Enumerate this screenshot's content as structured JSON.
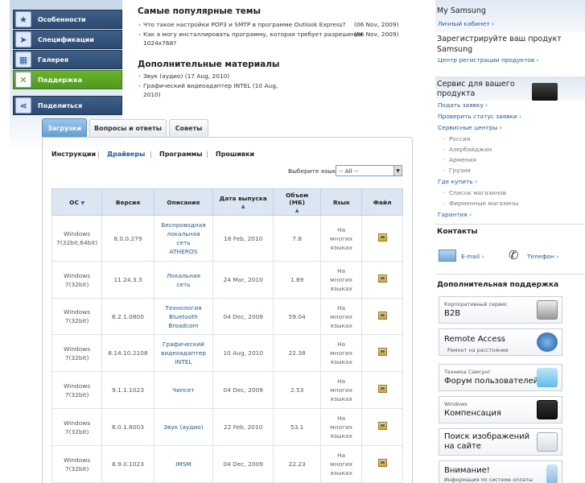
{
  "left_nav": [
    {
      "label": "Особенности",
      "icon": "star-icon"
    },
    {
      "label": "Спецификации",
      "icon": "cursor-icon"
    },
    {
      "label": "Галерея",
      "icon": "gallery-icon"
    },
    {
      "label": "Поддержка",
      "icon": "tools-icon",
      "active": true
    },
    {
      "label": "Поделиться",
      "icon": "share-icon"
    }
  ],
  "popular": {
    "title": "Самые популярные темы",
    "items": [
      {
        "text": "Что такое настройки POP3 и SMTP в программе Outlook Express?",
        "date": "(06 Nov, 2009)"
      },
      {
        "text": "Как я могу инсталлировать программу, которая требует разрешения",
        "text2": "1024x768?",
        "date": "(06 Nov, 2009)"
      }
    ]
  },
  "extra": {
    "title": "Дополнительные материалы",
    "item1": "Звук (аудио)   (17 Aug, 2010)",
    "item2a": "Графический видеоадаптер INTEL   (10 Aug,",
    "item2b": "2010)"
  },
  "tabs": [
    "Загрузки",
    "Вопросы и ответы",
    "Советы"
  ],
  "subtabs": [
    "Инструкции",
    "Драйверы",
    "Программы",
    "Прошивки"
  ],
  "language": {
    "label": "Выберите язык",
    "value": "-- All --"
  },
  "table": {
    "headers": [
      "ОС",
      "Версия",
      "Описание",
      "Дата выпуска",
      "Объем (МБ)",
      "Язык",
      "Файл"
    ],
    "rows": [
      {
        "os1": "Windows",
        "os2": "7(32bit,64bit)",
        "ver": "8.0.0.279",
        "d1": "Беспроводная",
        "d2": "локальная",
        "d3": "сеть",
        "d4": "ATHEROS",
        "date": "18 Feb, 2010",
        "size": "7.8",
        "l1": "На",
        "l2": "многих",
        "l3": "языках"
      },
      {
        "os1": "Windows",
        "os2": "7(32bit)",
        "ver": "11.24.3.3",
        "d1": "Локальная",
        "d2": "сеть",
        "d3": "",
        "d4": "",
        "date": "24 Mar, 2010",
        "size": "1.69",
        "l1": "На",
        "l2": "многих",
        "l3": "языках"
      },
      {
        "os1": "Windows",
        "os2": "7(32bit)",
        "ver": "6.2.1.0800",
        "d1": "Технология",
        "d2": "Bluetooth",
        "d3": "Broadcom",
        "d4": "",
        "date": "04 Dec, 2009",
        "size": "59.04",
        "l1": "На",
        "l2": "многих",
        "l3": "языках"
      },
      {
        "os1": "Windows",
        "os2": "7(32bit)",
        "ver": "8.14.10.2108",
        "d1": "Графический",
        "d2": "видеоадаптер",
        "d3": "INTEL",
        "d4": "",
        "date": "10 Aug, 2010",
        "size": "22.38",
        "l1": "На",
        "l2": "многих",
        "l3": "языках"
      },
      {
        "os1": "Windows",
        "os2": "7(32bit)",
        "ver": "9.1.1.1023",
        "d1": "Чипсет",
        "d2": "",
        "d3": "",
        "d4": "",
        "date": "04 Dec, 2009",
        "size": "2.53",
        "l1": "На",
        "l2": "многих",
        "l3": "языках"
      },
      {
        "os1": "Windows",
        "os2": "7(32bit)",
        "ver": "6.0.1.6003",
        "d1": "Звук (аудио)",
        "d2": "",
        "d3": "",
        "d4": "",
        "date": "22 Feb, 2010",
        "size": "53.1",
        "l1": "На",
        "l2": "многих",
        "l3": "языках"
      },
      {
        "os1": "Windows",
        "os2": "7(32bit)",
        "ver": "8.9.0.1023",
        "d1": "IMSM",
        "d2": "",
        "d3": "",
        "d4": "",
        "date": "04 Dec, 2009",
        "size": "22.23",
        "l1": "На",
        "l2": "многих",
        "l3": "языках"
      }
    ]
  },
  "right": {
    "my_samsung": "My Samsung",
    "cabinet": "Личный кабинет",
    "register_title1": "Зарегистрируйте ваш продукт",
    "register_title2": "Samsung",
    "register_link": "Центр регистрации продуктов",
    "service_title1": "Сервис для вашего",
    "service_title2": "продукта",
    "service_links": [
      "Подать заявку",
      "Проверить статус заявки",
      "Сервисные центры"
    ],
    "countries": [
      "Россия",
      "Азербайджан",
      "Армения",
      "Грузия"
    ],
    "buy_link": "Где купить",
    "shops": [
      "Список магазинов",
      "Фирменные магазины"
    ],
    "warranty": "Гарантия",
    "contacts_title": "Контакты",
    "email": "E-mail",
    "phone": "Телефон",
    "support_title": "Дополнительная поддержка",
    "boxes": [
      {
        "small": "Корпоративный сервис",
        "big": "B2B",
        "sub": ""
      },
      {
        "small": "",
        "big": "Remote Access",
        "sub": "Ремонт на расстоянии"
      },
      {
        "small": "Техника Самсунг",
        "big": "Форум пользователей",
        "sub": ""
      },
      {
        "small": "Windows",
        "big": "Компенсация",
        "sub": ""
      },
      {
        "small": "",
        "big": "Поиск изображений на сайте",
        "sub": ""
      },
      {
        "small": "",
        "big": "Внимание!",
        "sub": "Информация по системе оплаты"
      }
    ]
  }
}
